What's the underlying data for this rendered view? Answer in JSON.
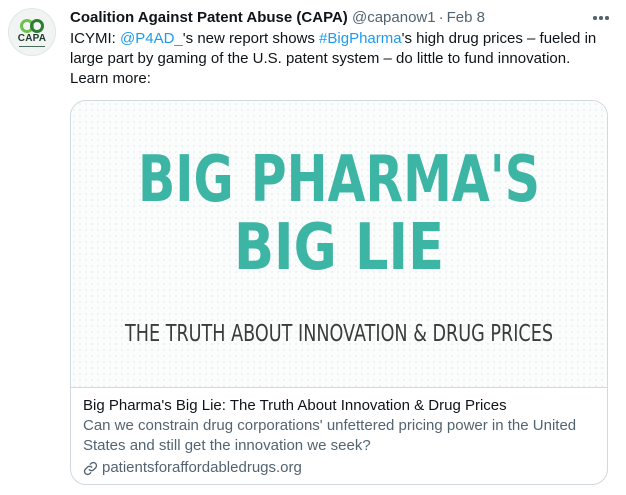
{
  "author": {
    "name": "Coalition Against Patent Abuse (CAPA)",
    "handle": "@capanow1",
    "separator": "·",
    "date": "Feb 8",
    "avatar_label": "CAPA"
  },
  "tweet": {
    "prefix": "ICYMI: ",
    "mention": "@P4AD_",
    "part2": "'s new report shows ",
    "hashtag": "#BigPharma",
    "part3": "'s high drug prices – fueled in large part by gaming of the U.S. patent system – do little to fund innovation. Learn more:"
  },
  "card": {
    "image_headline_line1": "BIG PHARMA'S",
    "image_headline_line2": "BIG LIE",
    "image_subhead": "THE TRUTH ABOUT INNOVATION & DRUG PRICES",
    "title": "Big Pharma's Big Lie: The Truth About Innovation & Drug Prices",
    "description": "Can we constrain drug corporations' unfettered pricing power in the United States and still get the innovation we seek?",
    "domain": "patientsforaffordabledrugs.org"
  },
  "icons": {
    "more": "more-horizontal-icon",
    "link": "link-icon",
    "logo": "capa-logo-icon"
  },
  "colors": {
    "accent": "#1d9bf0",
    "headline_teal": "#3db5a5",
    "secondary_text": "#536471"
  }
}
